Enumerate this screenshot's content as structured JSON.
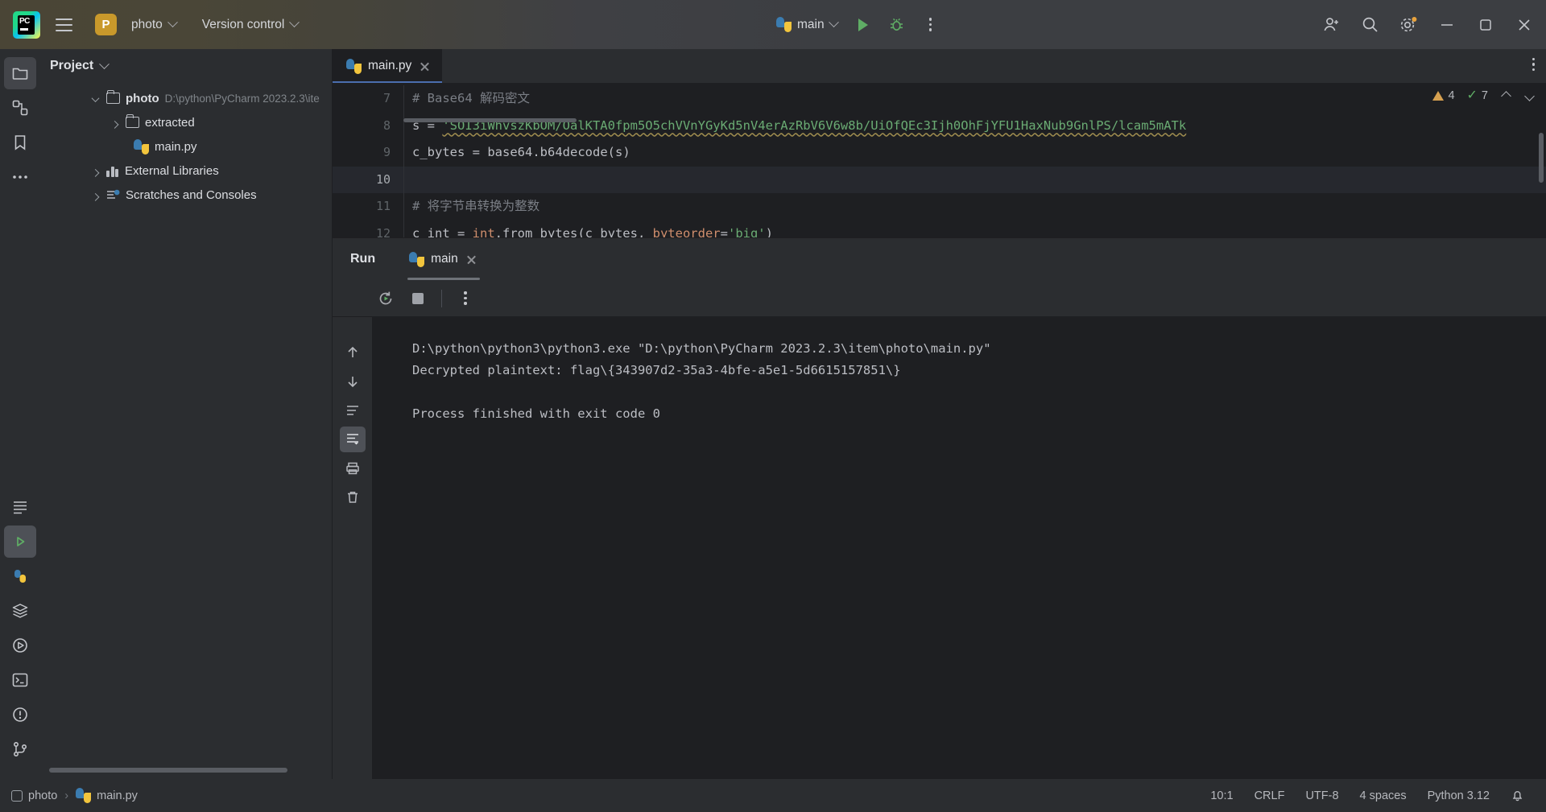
{
  "titlebar": {
    "project_badge": "P",
    "project_name": "photo",
    "version_control": "Version control",
    "run_config": "main",
    "icons": {
      "app_logo": "pycharm-logo-icon",
      "menu": "hamburger-menu-icon",
      "run": "run-icon",
      "debug": "debug-icon",
      "more": "more-actions-icon",
      "account": "account-icon",
      "search": "search-everywhere-icon",
      "settings": "settings-icon",
      "minimize": "minimize-icon",
      "maximize": "maximize-icon",
      "close": "close-icon"
    }
  },
  "project_panel": {
    "title": "Project",
    "tree": [
      {
        "label": "photo",
        "path": "D:\\python\\PyCharm 2023.2.3\\ite",
        "icon": "folder-icon",
        "expanded": true,
        "depth": 0,
        "bold": true
      },
      {
        "label": "extracted",
        "path": "",
        "icon": "folder-icon",
        "expanded": false,
        "depth": 1,
        "bold": false
      },
      {
        "label": "main.py",
        "path": "",
        "icon": "python-file-icon",
        "expanded": null,
        "depth": 2,
        "bold": false
      },
      {
        "label": "External Libraries",
        "path": "",
        "icon": "library-icon",
        "expanded": false,
        "depth": 0,
        "bold": false
      },
      {
        "label": "Scratches and Consoles",
        "path": "",
        "icon": "scratches-icon",
        "expanded": false,
        "depth": 0,
        "bold": false
      }
    ]
  },
  "editor": {
    "tab_label": "main.py",
    "tab_icon": "python-file-icon",
    "inspection": {
      "warnings": "4",
      "checks": "7"
    },
    "lines": [
      {
        "num": "7",
        "current": false,
        "tokens": [
          {
            "t": "# Base64 解码密文",
            "c": "cmt"
          }
        ]
      },
      {
        "num": "8",
        "current": false,
        "tokens": [
          {
            "t": "s ",
            "c": "plain"
          },
          {
            "t": "= ",
            "c": "plain"
          },
          {
            "t": "'SOI3iWhvszKbOM/OalKTA0fpm5O5chVVnYGyKd5nV4erAzRbV6V6w8b/UiOfQEc3Ijh0OhFjYFU1HaxNub9GnlPS/lcam5mATk",
            "c": "str wavy"
          }
        ]
      },
      {
        "num": "9",
        "current": false,
        "tokens": [
          {
            "t": "c_bytes ",
            "c": "plain"
          },
          {
            "t": "= ",
            "c": "plain"
          },
          {
            "t": "base64",
            "c": "plain"
          },
          {
            "t": ".",
            "c": "plain"
          },
          {
            "t": "b64decode",
            "c": "plain"
          },
          {
            "t": "(s)",
            "c": "plain"
          }
        ]
      },
      {
        "num": "10",
        "current": true,
        "tokens": [
          {
            "t": "",
            "c": "plain"
          }
        ]
      },
      {
        "num": "11",
        "current": false,
        "tokens": [
          {
            "t": "# 将字节串转换为整数",
            "c": "cmt"
          }
        ]
      },
      {
        "num": "12",
        "current": false,
        "tokens": [
          {
            "t": "c_int ",
            "c": "plain"
          },
          {
            "t": "= ",
            "c": "plain"
          },
          {
            "t": "int",
            "c": "kw"
          },
          {
            "t": ".from_bytes(c_bytes, ",
            "c": "plain"
          },
          {
            "t": "byteorder",
            "c": "kw"
          },
          {
            "t": "=",
            "c": "plain"
          },
          {
            "t": "'big'",
            "c": "str"
          },
          {
            "t": ")",
            "c": "plain"
          }
        ]
      }
    ]
  },
  "run_panel": {
    "title": "Run",
    "tab_label": "main",
    "tab_icon": "python-file-icon",
    "toolbar": {
      "rerun": "rerun-icon",
      "stop": "stop-icon",
      "more": "more-actions-icon"
    },
    "console_lines": [
      "D:\\python\\python3\\python3.exe \"D:\\python\\PyCharm 2023.2.3\\item\\photo\\main.py\"",
      "Decrypted plaintext: flag\\{343907d2-35a3-4bfe-a5e1-5d6615157851\\}",
      "",
      "Process finished with exit code 0"
    ]
  },
  "status_bar": {
    "breadcrumbs": [
      {
        "label": "photo",
        "icon": "module-icon"
      },
      {
        "label": "main.py",
        "icon": "python-file-icon"
      }
    ],
    "caret_position": "10:1",
    "line_separator": "CRLF",
    "encoding": "UTF-8",
    "indent": "4 spaces",
    "interpreter": "Python 3.12"
  }
}
